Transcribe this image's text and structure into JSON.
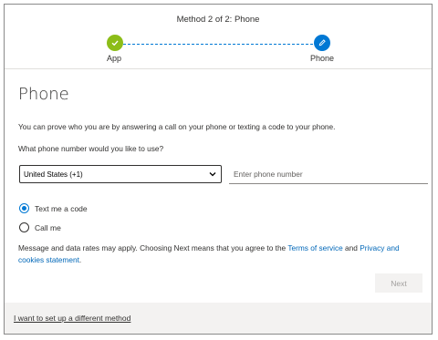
{
  "header": {
    "step_title": "Method 2 of 2: Phone",
    "steps": [
      {
        "label": "App",
        "state": "complete",
        "color": "#8cbd18",
        "icon": "checkmark-icon"
      },
      {
        "label": "Phone",
        "state": "current",
        "color": "#0078d4",
        "icon": "pencil-icon"
      }
    ]
  },
  "main": {
    "title": "Phone",
    "description": "You can prove who you are by answering a call on your phone or texting a code to your phone.",
    "question": "What phone number would you like to use?",
    "country_select": {
      "value": "United States (+1)"
    },
    "phone_input": {
      "placeholder": "Enter phone number",
      "value": ""
    },
    "radio_options": [
      {
        "label": "Text me a code",
        "checked": true
      },
      {
        "label": "Call me",
        "checked": false
      }
    ],
    "disclaimer": {
      "text_before": "Message and data rates may apply. Choosing Next means that you agree to the ",
      "terms_link": "Terms of service",
      "text_middle": " and ",
      "privacy_link": "Privacy and cookies statement",
      "text_after": "."
    },
    "next_button": {
      "label": "Next",
      "enabled": false
    }
  },
  "footer": {
    "alt_method_link": "I want to set up a different method"
  },
  "colors": {
    "accent": "#0078d4",
    "success": "#8cbd18",
    "link": "#0067b8",
    "disabled_bg": "#f3f2f1"
  }
}
